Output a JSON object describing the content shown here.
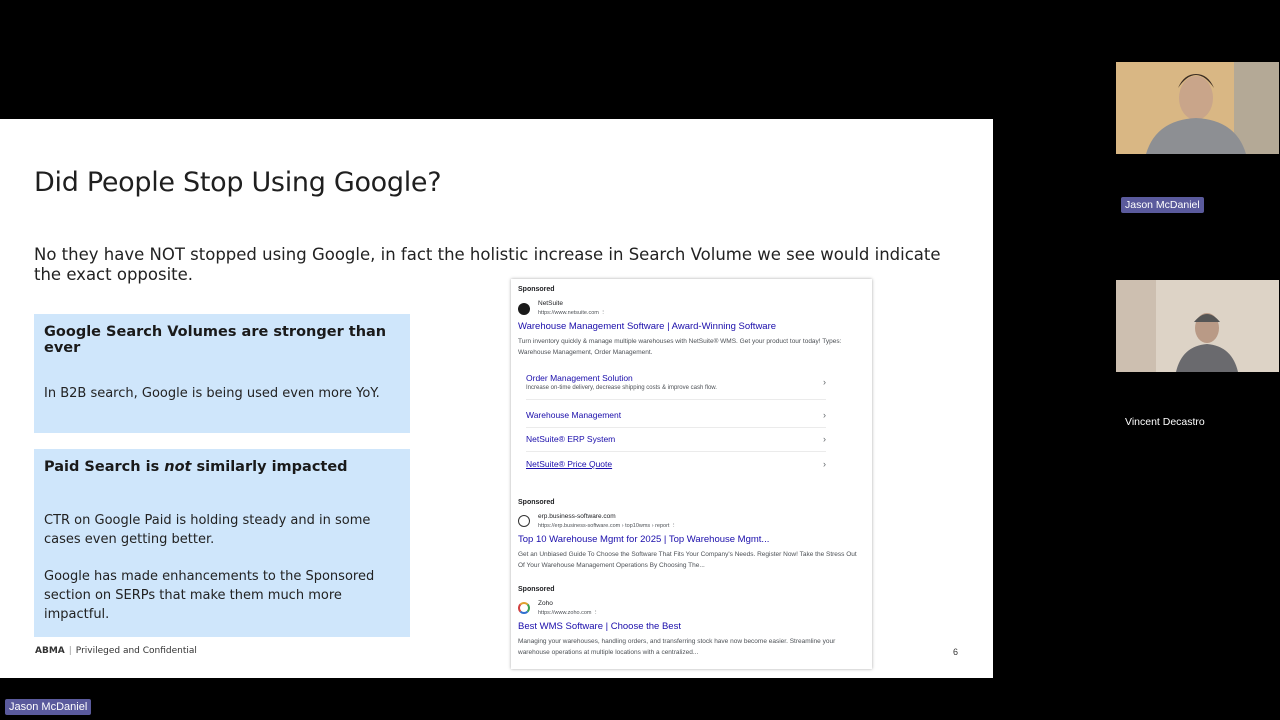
{
  "slide": {
    "title": "Did People Stop Using Google?",
    "intro": "No they have NOT stopped using Google, in fact the holistic increase in Search Volume we see would indicate the exact opposite.",
    "panel1": {
      "heading": "Google Search Volumes are stronger than ever",
      "text": "In B2B search, Google is being used even more YoY."
    },
    "panel2": {
      "heading_pre": "Paid Search is ",
      "heading_em": "not",
      "heading_post": " similarly impacted",
      "text1": "CTR on Google Paid is holding steady and in some cases even getting better.",
      "text2": "Google has made enhancements to the Sponsored section on SERPs that make them much more impactful."
    },
    "footer": {
      "brand": "ABMA",
      "separator": "|",
      "label": "Privileged and Confidential"
    },
    "page_number": "6"
  },
  "serp": {
    "ads": [
      {
        "sponsored": "Sponsored",
        "site": "NetSuite",
        "url": "https://www.netsuite.com",
        "title": "Warehouse Management Software | Award-Winning Software",
        "description": "Turn inventory quickly & manage multiple warehouses with NetSuite® WMS. Get your product tour today! Types: Warehouse Management, Order Management.",
        "sitelinks": [
          {
            "title": "Order Management Solution",
            "desc": "Increase on-time delivery, decrease shipping costs & improve cash flow."
          },
          {
            "title": "Warehouse Management",
            "desc": ""
          },
          {
            "title": "NetSuite® ERP System",
            "desc": ""
          },
          {
            "title": "NetSuite® Price Quote",
            "desc": ""
          }
        ]
      },
      {
        "sponsored": "Sponsored",
        "site": "erp.business-software.com",
        "url": "https://erp.business-software.com › top10wms › report",
        "title": "Top 10 Warehouse Mgmt for 2025 | Top Warehouse Mgmt...",
        "description": "Get an Unbiased Guide To Choose the Software That Fits Your Company's Needs. Register Now! Take the Stress Out Of Your Warehouse Management Operations By Choosing The..."
      },
      {
        "sponsored": "Sponsored",
        "site": "Zoho",
        "url": "https://www.zoho.com",
        "title": "Best WMS Software | Choose the Best",
        "description": "Managing your warehouses, handling orders, and transferring stock have now become easier. Streamline your warehouse operations at multiple locations with a centralized..."
      }
    ],
    "more_icon": "⋮",
    "chevron_icon": "›"
  },
  "participants": [
    {
      "name": "Jason McDaniel"
    },
    {
      "name": "Vincent Decastro"
    }
  ],
  "active_speaker": "Jason McDaniel",
  "colors": {
    "panel": "#cfe6fb",
    "link": "#1a0dab",
    "badge": "#5a5a9c"
  }
}
